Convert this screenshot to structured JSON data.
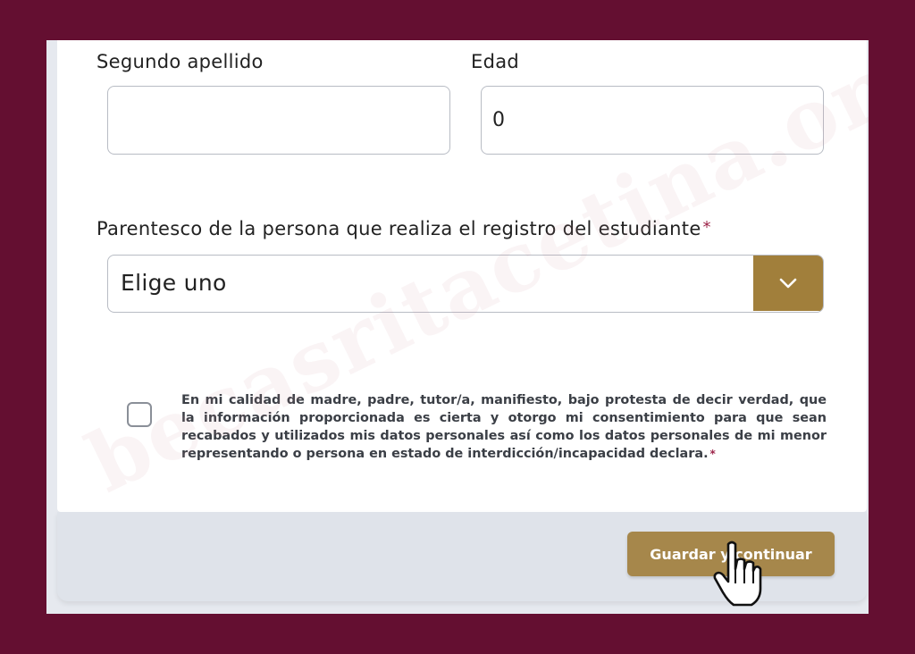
{
  "form": {
    "second_surname": {
      "label": "Segundo apellido",
      "value": ""
    },
    "age": {
      "label": "Edad",
      "value": "0"
    },
    "relationship": {
      "label": "Parentesco de la persona que realiza el registro del estudiante",
      "required_mark": "*",
      "selected": "Elige uno",
      "icon": "chevron-down-icon"
    },
    "consent": {
      "text": "En mi calidad de madre, padre, tutor/a, manifiesto, bajo protesta de decir verdad, que la información proporcionada es cierta y otorgo mi consentimiento para que sean recabados y utilizados mis datos personales así como los datos personales de mi menor representando o persona en estado de interdicción/incapacidad declara.",
      "required_mark": "*",
      "checked": false
    },
    "submit_label": "Guardar y continuar"
  },
  "watermark": "becasritacetina.org",
  "colors": {
    "border": "#640f31",
    "accent": "#a17f3b",
    "button": "#a6874b",
    "required": "#9d2449"
  }
}
